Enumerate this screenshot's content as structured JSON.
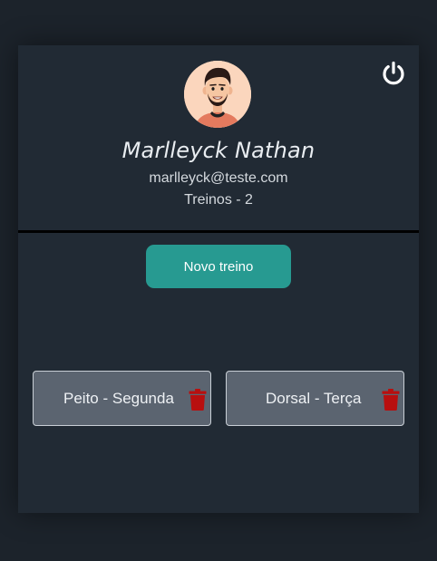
{
  "profile": {
    "name": "Marlleyck Nathan",
    "email": "marlleyck@teste.com",
    "workout_count": "Treinos - 2",
    "avatar_icon": "avatar-illustration"
  },
  "header": {
    "power_icon": "power-icon"
  },
  "actions": {
    "new_workout_label": "Novo treino"
  },
  "workouts": [
    {
      "label": "Peito - Segunda",
      "delete_icon": "trash-icon"
    },
    {
      "label": "Dorsal - Terça",
      "delete_icon": "trash-icon"
    }
  ],
  "colors": {
    "background": "#1c232b",
    "card": "#212a34",
    "accent": "#279a91",
    "workout_card": "#5b6470",
    "delete": "#b80f0f"
  }
}
